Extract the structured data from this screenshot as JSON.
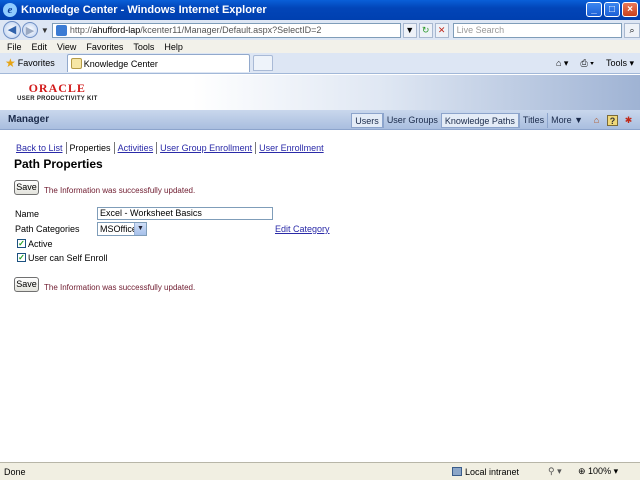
{
  "window": {
    "title": "Knowledge Center - Windows Internet Explorer",
    "controls": [
      "_",
      "□",
      "×"
    ]
  },
  "address_bar": {
    "url_prefix": "http://",
    "url_host": "ahufford-lap",
    "url_path": "/kcenter11/Manager/Default.aspx?SelectID=2",
    "search_placeholder": "Live Search"
  },
  "menu": [
    "File",
    "Edit",
    "View",
    "Favorites",
    "Tools",
    "Help"
  ],
  "tabs": {
    "favorites_label": "Favorites",
    "active_tab_label": "Knowledge Center",
    "tools_label": "Tools"
  },
  "brand": {
    "logo_text": "ORACLE",
    "logo_subtext": "USER PRODUCTIVITY KIT"
  },
  "manager": {
    "title": "Manager",
    "nav": [
      "Users",
      "User Groups",
      "Knowledge Paths",
      "Titles",
      "More ▼"
    ],
    "active_nav": "Knowledge Paths"
  },
  "subnav": {
    "back": "Back to List",
    "current": "Properties",
    "activities": "Activities",
    "group_enrollment": "User Group Enrollment",
    "user_enrollment": "User Enrollment"
  },
  "page": {
    "title": "Path Properties",
    "save_label": "Save",
    "message": "The Information was successfully updated.",
    "name_label": "Name",
    "name_value": "Excel - Worksheet Basics",
    "category_label": "Path Categories",
    "category_value": "MSOffice",
    "edit_category": "Edit Category",
    "active_label": "Active",
    "active_checked": true,
    "self_enroll_label": "User can Self Enroll",
    "self_enroll_checked": true
  },
  "status": {
    "text": "Done",
    "zone": "Local intranet",
    "zoom": "100%"
  }
}
